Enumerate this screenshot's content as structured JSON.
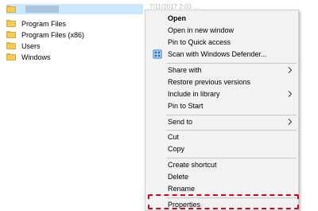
{
  "explorer": {
    "items": [
      {
        "name": "",
        "selected": true
      },
      {
        "name": "Program Files"
      },
      {
        "name": "Program Files (x86)"
      },
      {
        "name": "Users"
      },
      {
        "name": "Windows"
      }
    ]
  },
  "context_menu": {
    "items": [
      {
        "label": "Open",
        "bold": true
      },
      {
        "label": "Open in new window"
      },
      {
        "label": "Pin to Quick access"
      },
      {
        "label": "Scan with Windows Defender...",
        "icon": "windows-defender-icon"
      },
      {
        "label": "Share with",
        "submenu": true
      },
      {
        "label": "Restore previous versions"
      },
      {
        "label": "Include in library",
        "submenu": true
      },
      {
        "label": "Pin to Start"
      },
      {
        "label": "Send to",
        "submenu": true
      },
      {
        "label": "Cut"
      },
      {
        "label": "Copy"
      },
      {
        "label": "Create shortcut"
      },
      {
        "label": "Delete"
      },
      {
        "label": "Rename"
      },
      {
        "label": "Properties",
        "highlighted": true
      }
    ]
  },
  "colors": {
    "selection": "#cce8ff",
    "menu_background": "#f2f2f2",
    "highlight_border": "#e0001b",
    "folder": "#f3cc5a"
  }
}
